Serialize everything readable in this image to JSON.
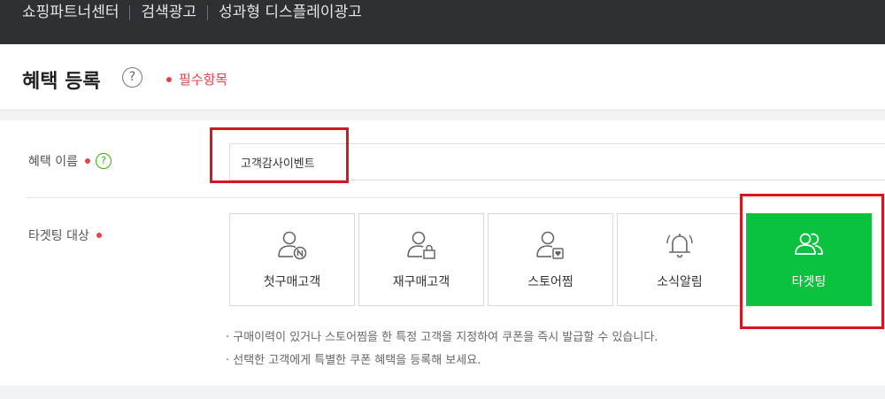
{
  "topnav": {
    "items": [
      "쇼핑파트너센터",
      "검색광고",
      "성과형 디스플레이광고"
    ]
  },
  "header": {
    "title": "혜택 등록",
    "help_glyph": "?",
    "required_note": "필수항목"
  },
  "form": {
    "name": {
      "label": "혜택 이름",
      "help_glyph": "?",
      "value": "고객감사이벤트"
    },
    "targeting": {
      "label": "타겟팅 대상",
      "options": [
        {
          "label": "첫구매고객",
          "icon": "user-n-icon",
          "selected": false
        },
        {
          "label": "재구매고객",
          "icon": "user-bag-icon",
          "selected": false
        },
        {
          "label": "스토어찜",
          "icon": "user-heart-icon",
          "selected": false
        },
        {
          "label": "소식알림",
          "icon": "bell-icon",
          "selected": false
        },
        {
          "label": "타겟팅",
          "icon": "users-icon",
          "selected": true
        }
      ],
      "hints": [
        "· 구매이력이 있거나 스토어찜을 한 특정 고객을 지정하여 쿠폰을 즉시 발급할 수 있습니다.",
        "· 선택한 고객에게 특별한 쿠폰 혜택을 등록해 보세요."
      ]
    }
  },
  "colors": {
    "topbar": "#2e3133",
    "accent_green": "#0bc23f",
    "required_red": "#e5414a",
    "highlight_red": "#d3191f"
  }
}
